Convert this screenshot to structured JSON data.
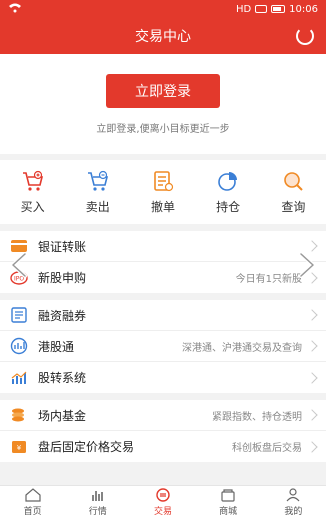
{
  "status_bar": {
    "time": "10:06",
    "badges": [
      "HD"
    ]
  },
  "header": {
    "title": "交易中心",
    "refresh_icon": "refresh-icon"
  },
  "login": {
    "button_label": "立即登录",
    "subtitle": "立即登录,便离小目标更近一步"
  },
  "actions": [
    {
      "label": "买入",
      "icon": "buy-cart-icon"
    },
    {
      "label": "卖出",
      "icon": "sell-cart-icon"
    },
    {
      "label": "撤单",
      "icon": "cancel-order-icon"
    },
    {
      "label": "持仓",
      "icon": "holdings-pie-icon"
    },
    {
      "label": "查询",
      "icon": "search-icon"
    }
  ],
  "group1": [
    {
      "label": "银证转账",
      "hint": "",
      "icon": "bank-card-icon"
    },
    {
      "label": "新股申购",
      "hint": "今日有1只新股",
      "icon": "ipo-icon"
    }
  ],
  "group2": [
    {
      "label": "融资融券",
      "hint": "",
      "icon": "margin-doc-icon"
    },
    {
      "label": "港股通",
      "hint": "深港通、沪港通交易及查询",
      "icon": "hk-stock-icon"
    },
    {
      "label": "股转系统",
      "hint": "",
      "icon": "equity-transfer-icon"
    }
  ],
  "group3": [
    {
      "label": "场内基金",
      "hint": "紧跟指数、持仓透明",
      "icon": "fund-coins-icon"
    },
    {
      "label": "盘后固定价格交易",
      "hint": "科创板盘后交易",
      "icon": "after-hours-icon"
    }
  ],
  "bottom_nav": [
    {
      "label": "首页",
      "icon": "home-icon",
      "active": false
    },
    {
      "label": "行情",
      "icon": "market-bars-icon",
      "active": false
    },
    {
      "label": "交易",
      "icon": "trade-icon",
      "active": true
    },
    {
      "label": "商城",
      "icon": "mall-icon",
      "active": false
    },
    {
      "label": "我的",
      "icon": "profile-icon",
      "active": false
    }
  ],
  "colors": {
    "brand_red": "#e3392c",
    "accent_orange": "#f08a24",
    "accent_blue": "#3b7fd6"
  }
}
